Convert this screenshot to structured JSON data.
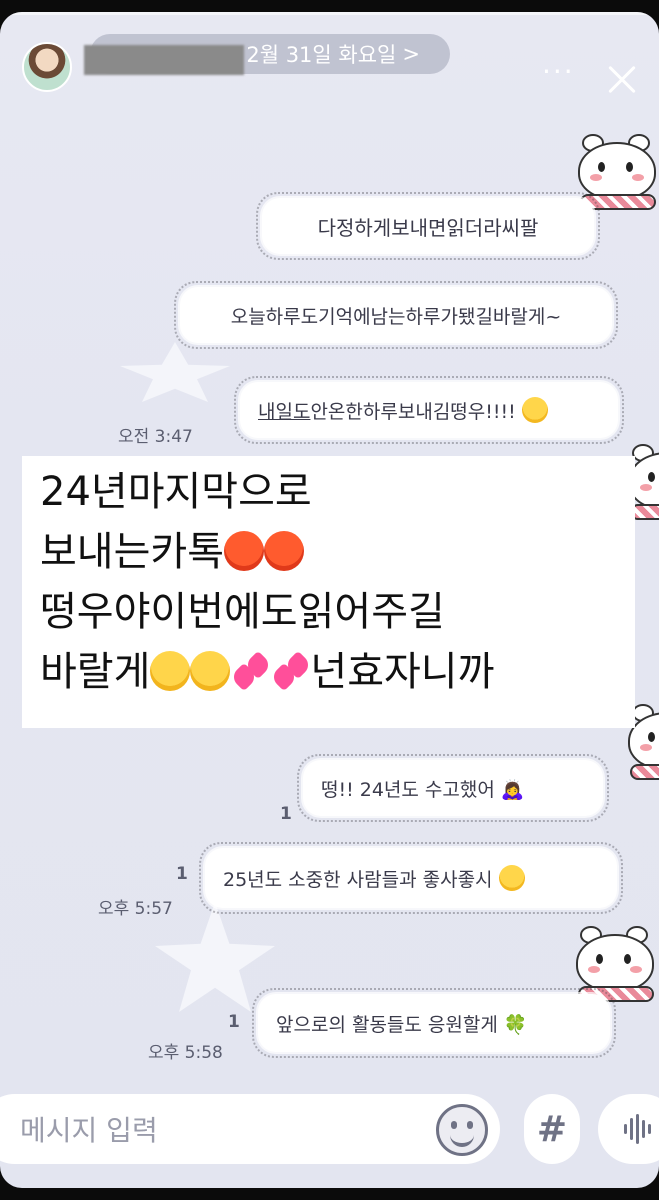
{
  "header": {
    "date_label": "2월 31일 화요일",
    "date_chevron": ">",
    "more_icon": "more-dots-icon",
    "close_icon": "close-icon"
  },
  "messages": [
    {
      "id": "m1",
      "text": "다정하게보내면읽더라씨팔"
    },
    {
      "id": "m2",
      "text": "오늘하루도기억에남는하루가됐길바랄게~"
    },
    {
      "id": "m3_underlined",
      "text": "내일도"
    },
    {
      "id": "m3_rest",
      "text": "안온한하루보내김떵우!!!!"
    },
    {
      "id": "m4",
      "text": "떵!! 24년도 수고했어 🙇‍♀️"
    },
    {
      "id": "m5",
      "text": "25년도 소중한 사람들과 좋사좋시"
    },
    {
      "id": "m6",
      "text": "앞으로의 활동들도 응원할게 🍀"
    }
  ],
  "meta": {
    "time_1": "오전 3:47",
    "unread_1": "1",
    "unread_2": "1",
    "time_2": "오후 5:57",
    "unread_3": "1",
    "time_3": "오후 5:58"
  },
  "overlay_text": {
    "line1": "24년마지막으로",
    "line2": "보내는카톡",
    "line3": "떵우야이번에도읽어주길",
    "line4a": "바랄게",
    "line4b": "넌효자니까"
  },
  "input": {
    "placeholder": "메시지 입력",
    "hash_label": "#"
  }
}
